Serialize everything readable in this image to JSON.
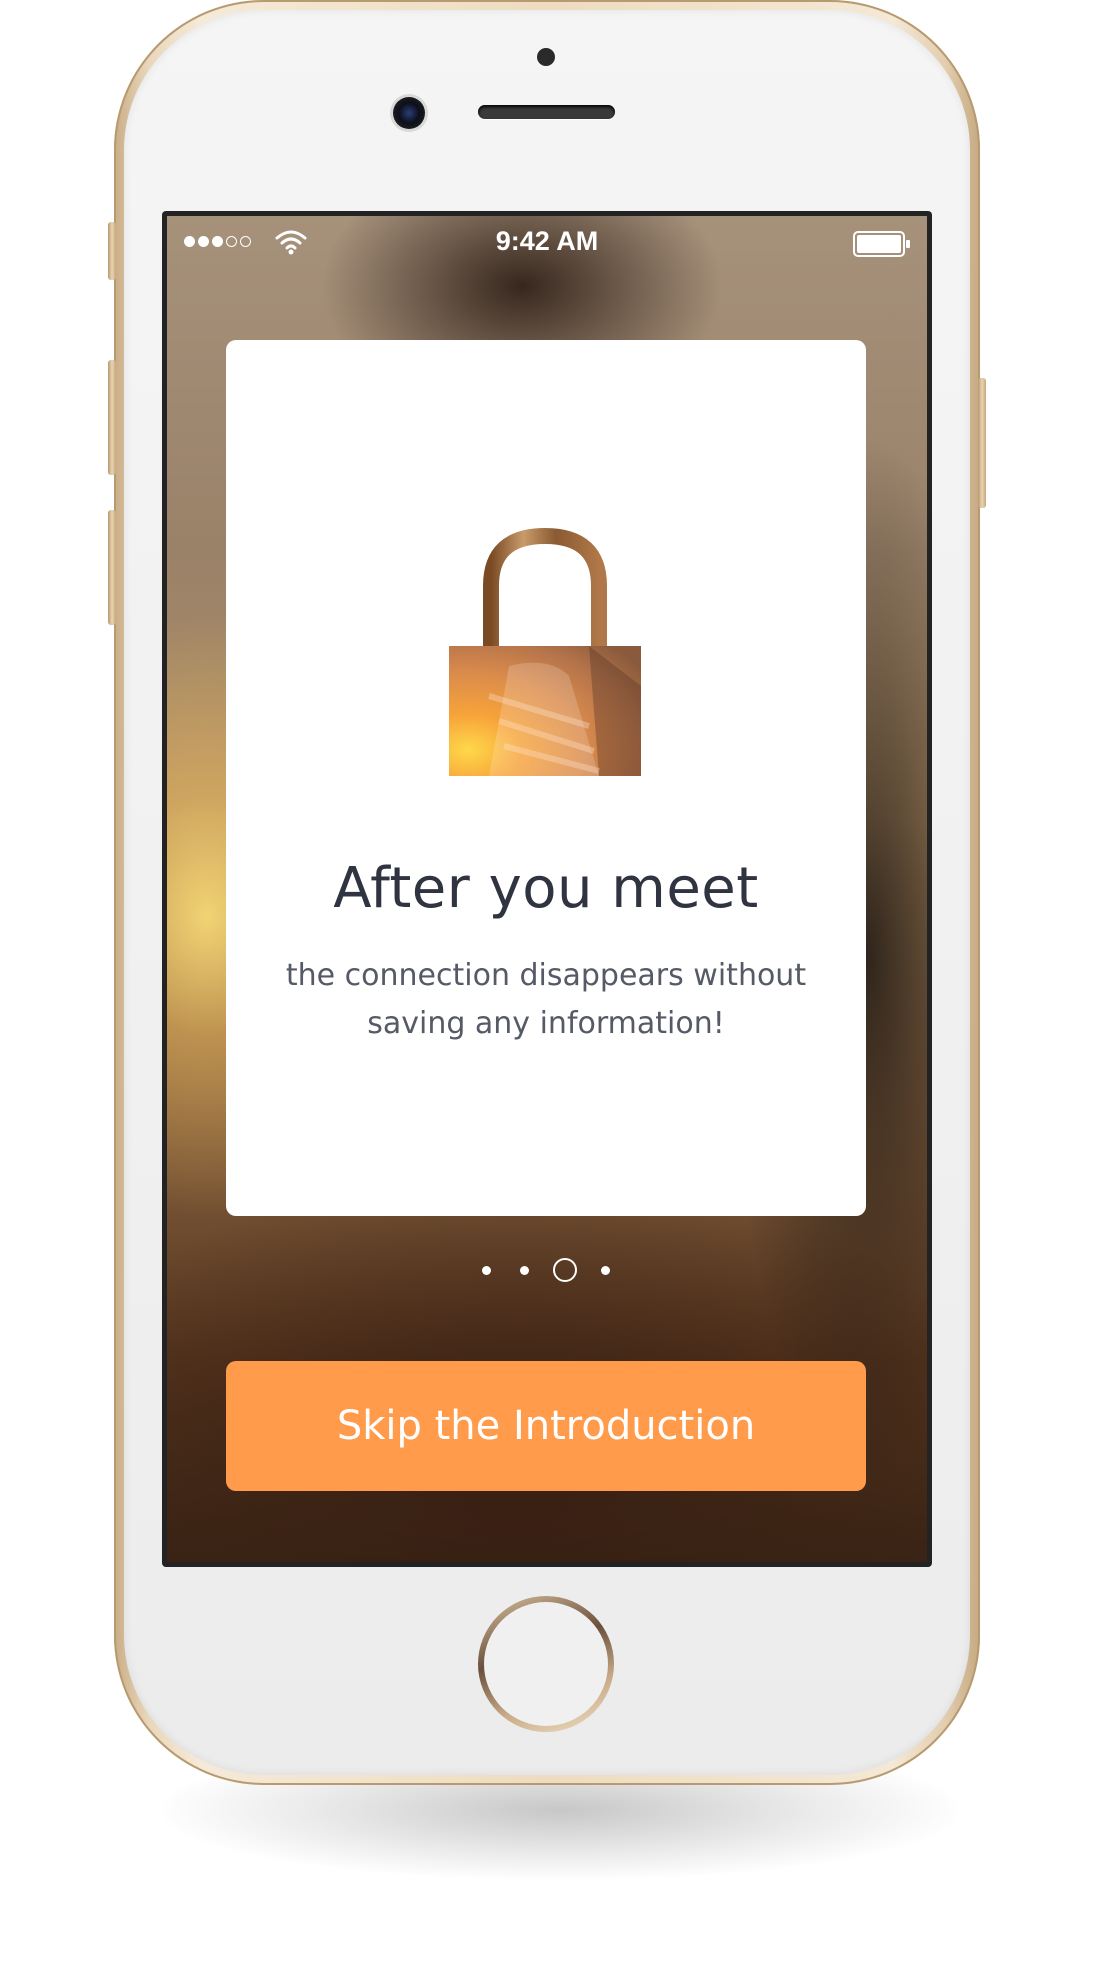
{
  "status_bar": {
    "signal_bars_filled": 3,
    "signal_bars_total": 5,
    "time": "9:42 AM"
  },
  "card": {
    "icon": "lock-icon",
    "title": "After you meet",
    "subtitle": "the connection disappears without saving any information!"
  },
  "pager": {
    "pages": 4,
    "active_index": 2
  },
  "actions": {
    "skip_label": "Skip the Introduction"
  },
  "colors": {
    "accent": "#ff9b4b",
    "title_text": "#2f3440",
    "body_text": "#555a66",
    "card_bg": "#ffffff"
  }
}
